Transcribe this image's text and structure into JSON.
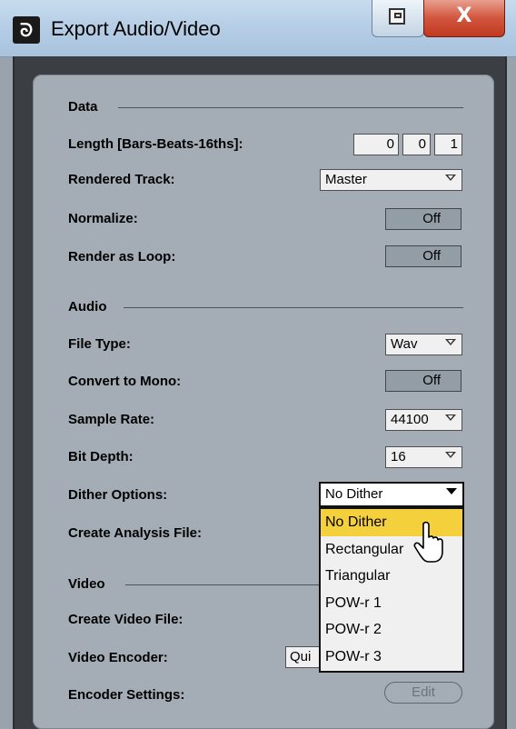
{
  "window": {
    "title": "Export Audio/Video",
    "app_icon_glyph": "ᘐ",
    "close_glyph": "X"
  },
  "data_section": {
    "heading": "Data",
    "length_label": "Length [Bars-Beats-16ths]:",
    "length_bars": "0",
    "length_beats": "0",
    "length_16ths": "1",
    "rendered_track_label": "Rendered Track:",
    "rendered_track_value": "Master",
    "normalize_label": "Normalize:",
    "normalize_value": "Off",
    "render_loop_label": "Render as Loop:",
    "render_loop_value": "Off"
  },
  "audio_section": {
    "heading": "Audio",
    "file_type_label": "File Type:",
    "file_type_value": "Wav",
    "mono_label": "Convert to Mono:",
    "mono_value": "Off",
    "sample_rate_label": "Sample Rate:",
    "sample_rate_value": "44100",
    "bit_depth_label": "Bit Depth:",
    "bit_depth_value": "16",
    "dither_label": "Dither Options:",
    "dither_value": "No Dither",
    "analysis_label": "Create Analysis File:",
    "dither_options": [
      "No Dither",
      "Rectangular",
      "Triangular",
      "POW-r 1",
      "POW-r 2",
      "POW-r 3"
    ]
  },
  "video_section": {
    "heading": "Video",
    "create_video_label": "Create Video File:",
    "encoder_label": "Video Encoder:",
    "encoder_value_visible": "Qui",
    "encoder_settings_label": "Encoder Settings:",
    "edit_label": "Edit"
  },
  "colors": {
    "highlight": "#f4d13c",
    "panel": "#a4adb6",
    "frame": "#3b3f44"
  },
  "icons": [
    "app-logo-icon",
    "restore-icon",
    "close-icon",
    "dropdown-arrow-icon",
    "mouse-cursor-icon"
  ]
}
